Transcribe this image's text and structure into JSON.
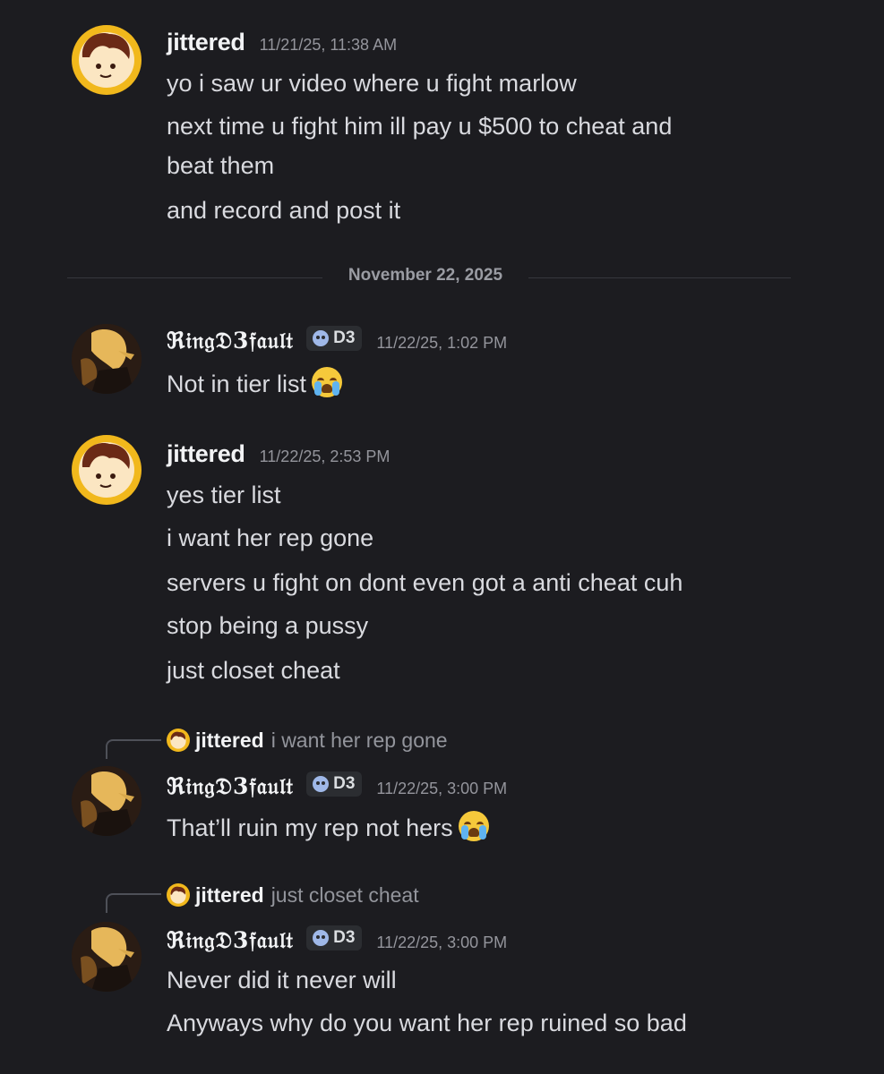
{
  "divider": {
    "date": "November 22, 2025"
  },
  "messages": [
    {
      "user": "jittered",
      "timestamp": "11/21/25, 11:38 AM",
      "lines": [
        "yo i saw ur video where u fight marlow",
        "next time u fight him ill pay u $500 to cheat and",
        "beat them",
        "and record and post it"
      ]
    },
    {
      "user": "ℜ𝔦𝔫𝔤𝔇3𝔣𝔞𝔲𝔩𝔱",
      "tag": "D3",
      "timestamp": "11/22/25, 1:02 PM",
      "lines": [
        "Not in tier list"
      ],
      "emoji": "loudly-crying-face"
    },
    {
      "user": "jittered",
      "timestamp": "11/22/25, 2:53 PM",
      "lines": [
        "yes tier list",
        "i want her rep gone",
        "servers u fight on dont even got a anti cheat cuh",
        "stop being a pussy",
        "just closet cheat"
      ]
    },
    {
      "reply": {
        "user": "jittered",
        "text": "i want her rep gone"
      },
      "user": "ℜ𝔦𝔫𝔤𝔇3𝔣𝔞𝔲𝔩𝔱",
      "tag": "D3",
      "timestamp": "11/22/25, 3:00 PM",
      "lines": [
        "That’ll ruin my rep not hers"
      ],
      "emoji": "loudly-crying-face"
    },
    {
      "reply": {
        "user": "jittered",
        "text": "just closet cheat"
      },
      "user": "ℜ𝔦𝔫𝔤𝔇3𝔣𝔞𝔲𝔩𝔱",
      "tag": "D3",
      "timestamp": "11/22/25, 3:00 PM",
      "lines": [
        "Never did it never will",
        "Anyways why do you want her rep ruined so bad"
      ]
    }
  ],
  "colors": {
    "background": "#1c1c20",
    "username": "#f2f3f5",
    "text": "#d9dadf",
    "timestamp": "#94959c",
    "avatar_jittered": "#f1b81c"
  }
}
